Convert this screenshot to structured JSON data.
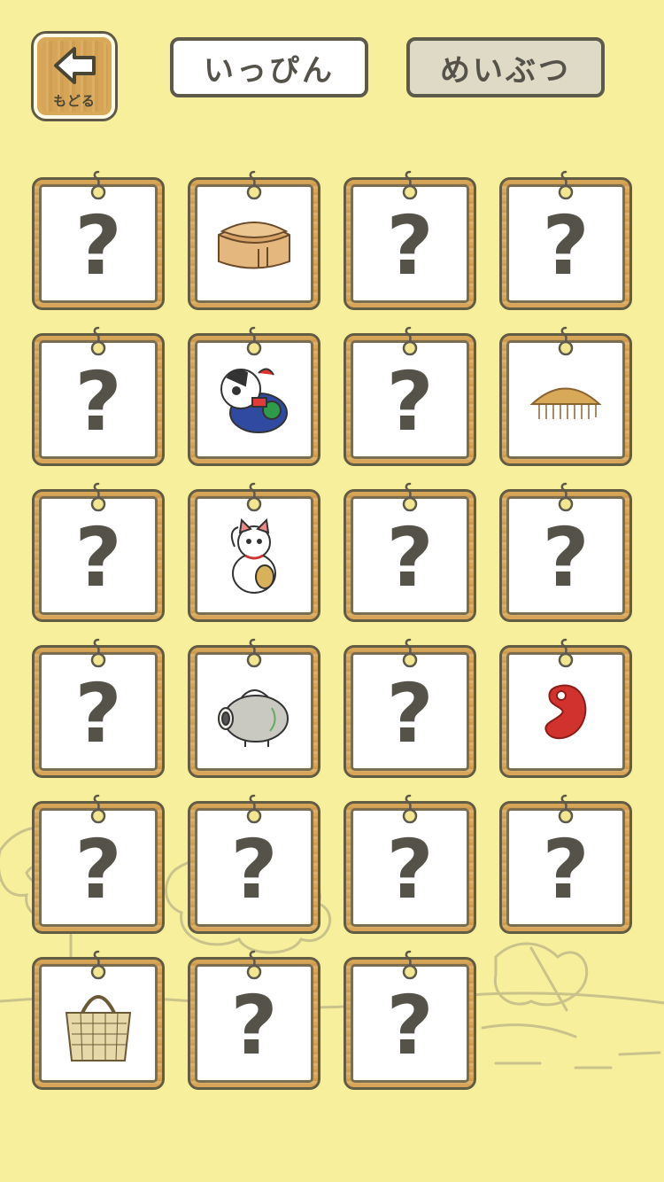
{
  "header": {
    "back_label": "もどる",
    "tabs": [
      {
        "label": "いっぴん",
        "active": true
      },
      {
        "label": "めいぶつ",
        "active": false
      }
    ]
  },
  "unknown_mark": "?",
  "colors": {
    "background": "#f7ef9c",
    "frame_wood": "#d6a557",
    "text_dark": "#555349"
  },
  "grid": {
    "cards": [
      {
        "state": "unknown"
      },
      {
        "state": "collected",
        "icon": "bento-box-icon"
      },
      {
        "state": "unknown"
      },
      {
        "state": "unknown"
      },
      {
        "state": "unknown"
      },
      {
        "state": "collected",
        "icon": "daruma-dog-doll-icon"
      },
      {
        "state": "unknown"
      },
      {
        "state": "collected",
        "icon": "wooden-comb-icon"
      },
      {
        "state": "unknown"
      },
      {
        "state": "collected",
        "icon": "maneki-neko-icon"
      },
      {
        "state": "unknown"
      },
      {
        "state": "unknown"
      },
      {
        "state": "unknown"
      },
      {
        "state": "collected",
        "icon": "pig-incense-holder-icon"
      },
      {
        "state": "unknown"
      },
      {
        "state": "collected",
        "icon": "magatama-icon"
      },
      {
        "state": "unknown"
      },
      {
        "state": "unknown"
      },
      {
        "state": "unknown"
      },
      {
        "state": "unknown"
      },
      {
        "state": "collected",
        "icon": "woven-basket-bag-icon"
      },
      {
        "state": "unknown"
      },
      {
        "state": "unknown"
      }
    ]
  }
}
